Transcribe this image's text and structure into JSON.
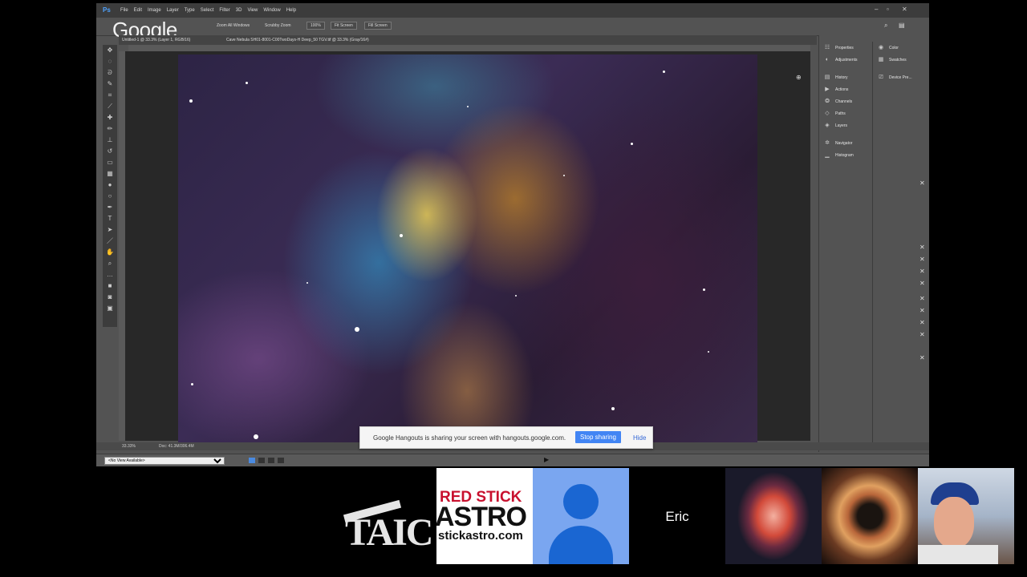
{
  "photoshop": {
    "logo": "Ps",
    "menu": [
      "File",
      "Edit",
      "Image",
      "Layer",
      "Type",
      "Select",
      "Filter",
      "3D",
      "View",
      "Window",
      "Help"
    ],
    "overlay_watermark": "Google",
    "options": {
      "zoom_all_windows": "Zoom All Windows",
      "scrubby_zoom": "Scrubby Zoom",
      "zoom_value": "100%",
      "fit_screen": "Fit Screen",
      "fill_screen": "Fill Screen"
    },
    "tabs": [
      "Untitled-1 @ 33.3% (Layer 1, RGB/16)",
      "Cave Nebula SH01-8001-C00TwoDays-H Deep_50 TGV.tif @ 33.3% (Gray/16#)"
    ],
    "panels_col1": [
      "Properties",
      "Adjustments",
      "History",
      "Actions",
      "Channels",
      "Paths",
      "Layers",
      "Navigator",
      "Histogram"
    ],
    "panels_col2": [
      "Color",
      "Swatches",
      "Device Pre..."
    ],
    "status_zoom": "33.33%",
    "status_doc": "Doc: 41.3M/306.4M",
    "view_select": "<No View Available>"
  },
  "share_bar": {
    "message": "Google Hangouts is sharing your screen with hangouts.google.com.",
    "stop": "Stop sharing",
    "hide": "Hide"
  },
  "participants": {
    "taic": "TAIC",
    "rsa_line1": "RED STICK",
    "rsa_line2": "ASTRO",
    "rsa_line3": "stickastro.com",
    "eric": "Eric"
  }
}
